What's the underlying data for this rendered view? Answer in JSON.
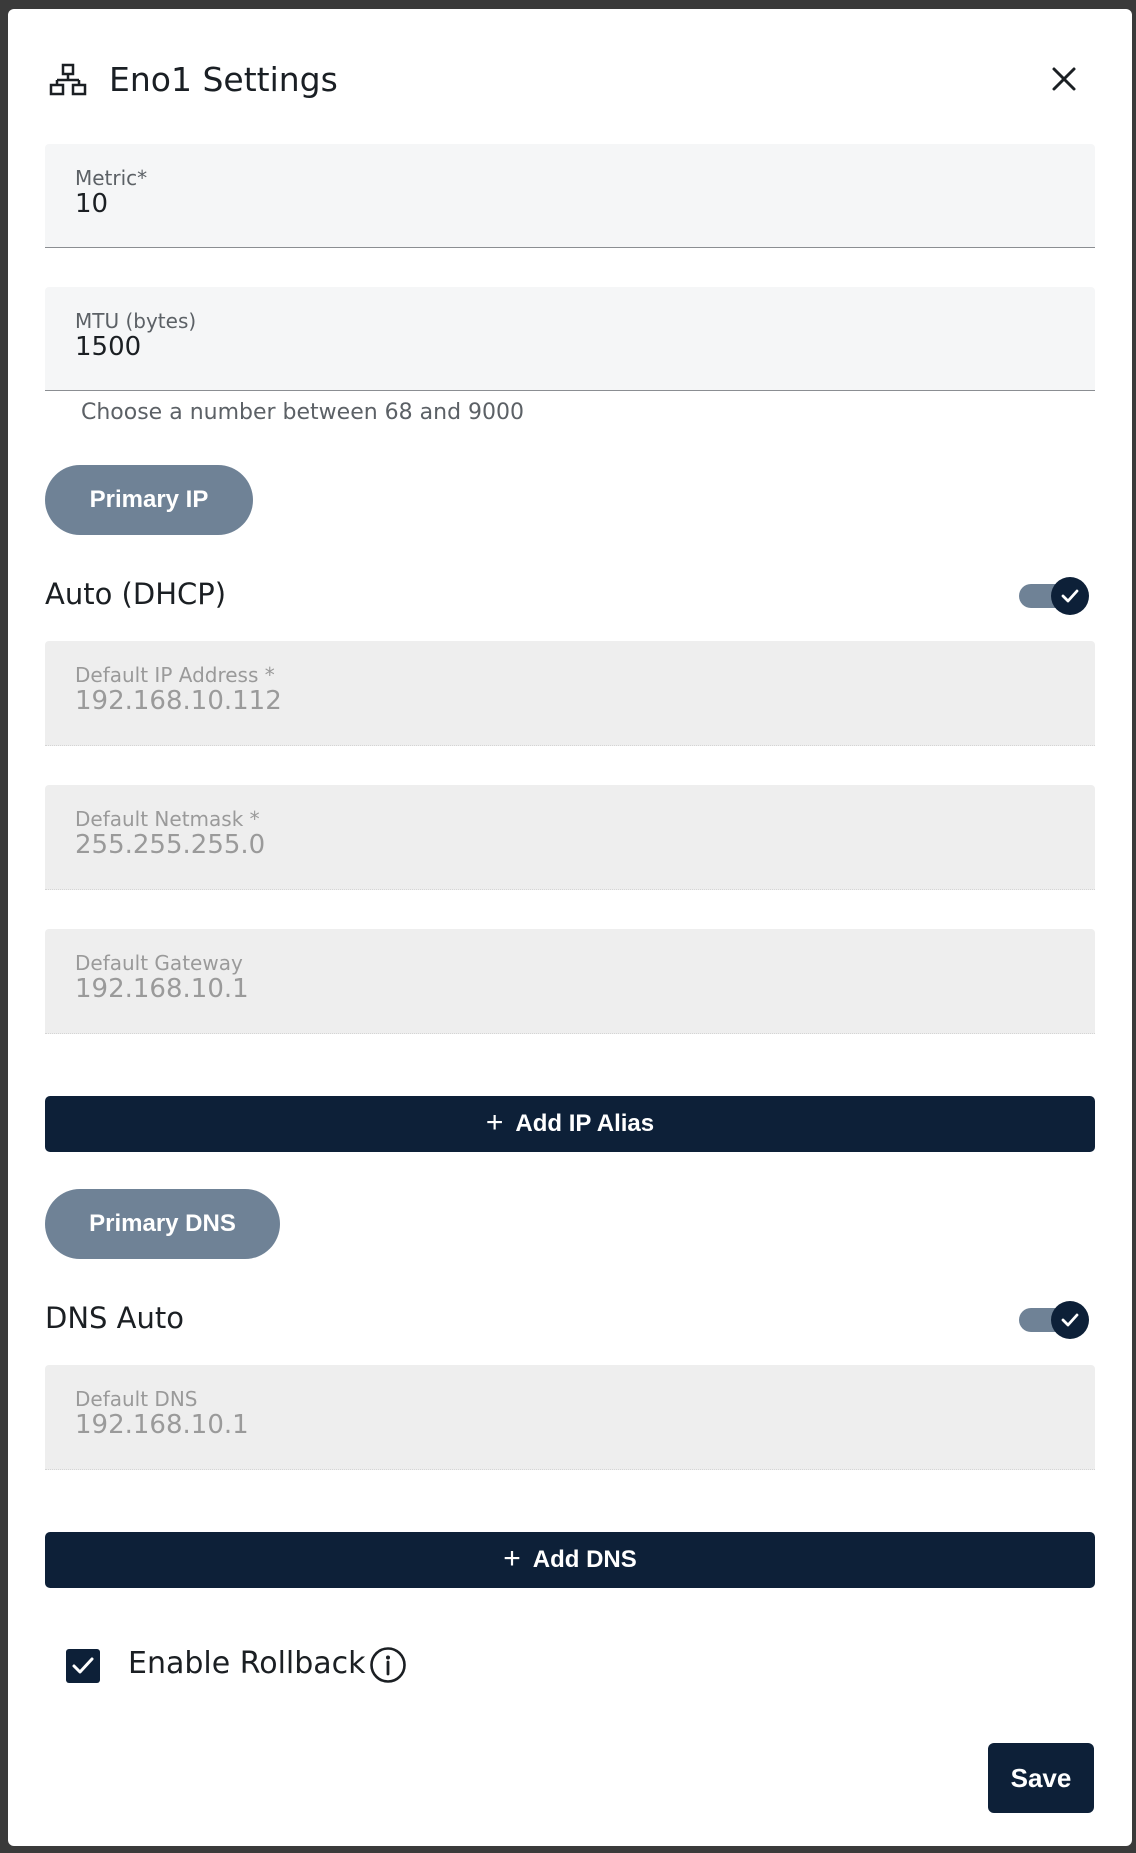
{
  "dialog": {
    "title": "Eno1 Settings",
    "header_icon": "network-icon",
    "close_icon": "close-icon"
  },
  "fields": {
    "metric": {
      "label": "Metric*",
      "value": "10"
    },
    "mtu": {
      "label": "MTU (bytes)",
      "value": "1500",
      "hint": "Choose a number between 68 and 9000"
    },
    "ip_address": {
      "label": "Default IP Address *",
      "value": "192.168.10.112"
    },
    "netmask": {
      "label": "Default Netmask *",
      "value": "255.255.255.0"
    },
    "gateway": {
      "label": "Default Gateway",
      "value": "192.168.10.1"
    },
    "dns": {
      "label": "Default DNS",
      "value": "192.168.10.1"
    }
  },
  "sections": {
    "primary_ip": "Primary IP",
    "primary_dns": "Primary DNS"
  },
  "switches": {
    "dhcp": {
      "label": "Auto (DHCP)",
      "checked": true
    },
    "dns_auto": {
      "label": "DNS Auto",
      "checked": true
    }
  },
  "buttons": {
    "add_ip_alias": "Add IP Alias",
    "add_dns": "Add DNS",
    "plus": "+",
    "save": "Save"
  },
  "rollback": {
    "label": "Enable Rollback",
    "checked": true,
    "info_icon": "info-icon"
  },
  "colors": {
    "primary": "#0d2038",
    "pill": "#6f8296",
    "field_bg": "#f5f6f7",
    "disabled_bg": "#eeeeee"
  }
}
